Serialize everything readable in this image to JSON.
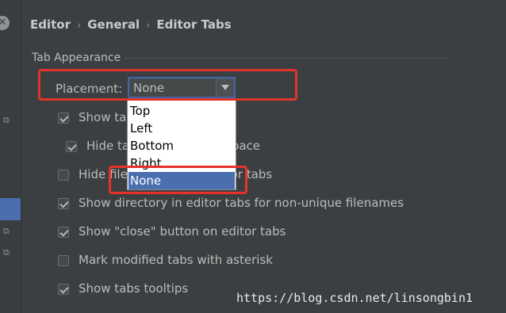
{
  "breadcrumb": [
    "Editor",
    "General",
    "Editor Tabs"
  ],
  "breadcrumb_separator": "›",
  "section": {
    "title": "Tab Appearance"
  },
  "placement": {
    "label": "Placement:",
    "selected": "None",
    "options": [
      "Top",
      "Left",
      "Bottom",
      "Right",
      "None"
    ]
  },
  "options": [
    {
      "label": "Show tabs in single row",
      "checked": true
    },
    {
      "label": "Hide tabs if there is no space",
      "checked": true
    },
    {
      "label": "Hide file extension in editor tabs",
      "checked": false
    },
    {
      "label": "Show directory in editor tabs for non-unique filenames",
      "checked": true
    },
    {
      "label": "Show \"close\" button on editor tabs",
      "checked": true
    },
    {
      "label": "Mark modified tabs with asterisk",
      "checked": false
    },
    {
      "label": "Show tabs tooltips",
      "checked": true
    }
  ],
  "watermark": "https://blog.csdn.net/linsongbin1",
  "colors": {
    "background": "#3c3f41",
    "selection": "#4b6eaf",
    "annotation": "#e3332a"
  }
}
